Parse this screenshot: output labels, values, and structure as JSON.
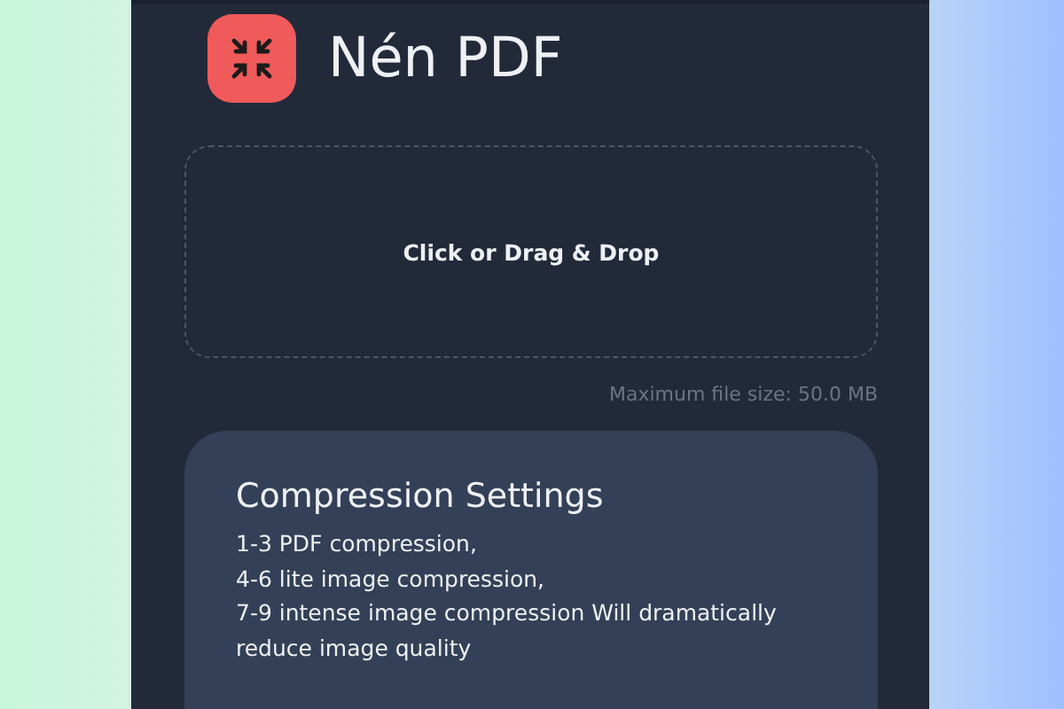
{
  "header": {
    "title": "Nén PDF"
  },
  "dropzone": {
    "label": "Click or Drag & Drop"
  },
  "max_size": "Maximum file size: 50.0 MB",
  "settings": {
    "title": "Compression Settings",
    "lines": [
      "1-3 PDF compression,",
      "4-6 lite image compression,",
      "7-9 intense image compression Will dramatically reduce image quality"
    ]
  }
}
